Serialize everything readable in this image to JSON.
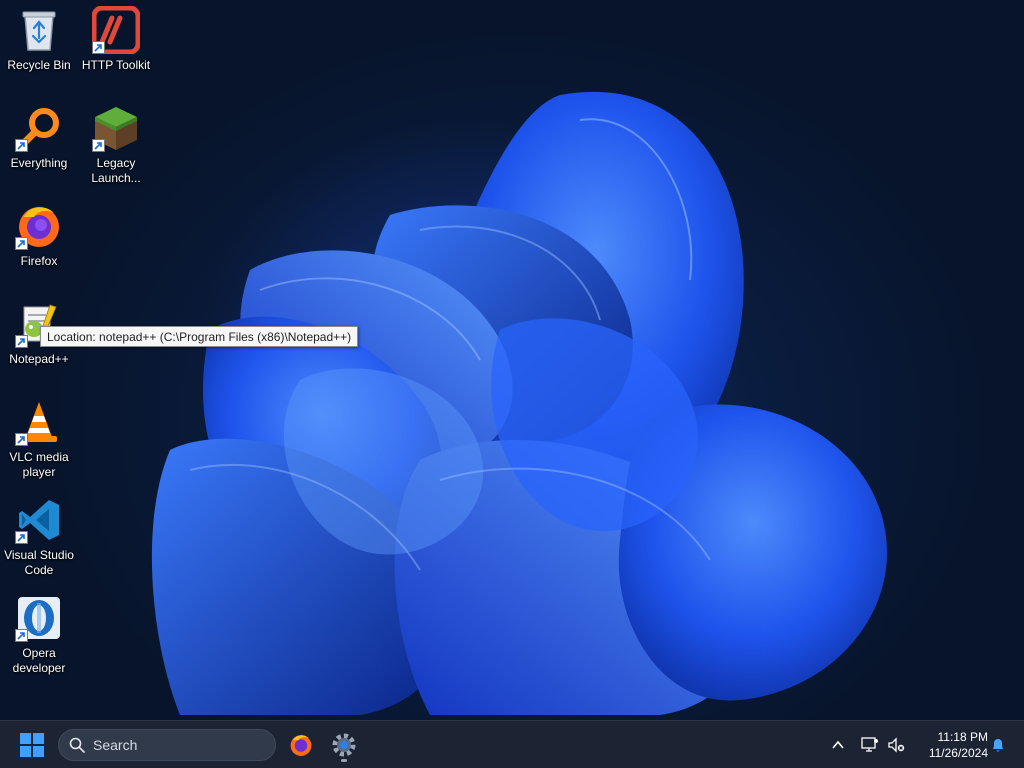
{
  "desktop": {
    "icons": [
      {
        "label": "Recycle Bin",
        "icon": "recycle-bin-icon"
      },
      {
        "label": "HTTP Toolkit",
        "icon": "http-toolkit-icon"
      },
      {
        "label": "Everything",
        "icon": "everything-search-icon"
      },
      {
        "label": "Legacy Launch...",
        "icon": "minecraft-grass-block-icon"
      },
      {
        "label": "Firefox",
        "icon": "firefox-icon"
      },
      {
        "label": "Notepad++",
        "icon": "notepad-plus-plus-icon"
      },
      {
        "label": "VLC media player",
        "icon": "vlc-cone-icon"
      },
      {
        "label": "Visual Studio Code",
        "icon": "vscode-icon"
      },
      {
        "label": "Opera developer",
        "icon": "opera-developer-icon"
      }
    ],
    "tooltip": "Location: notepad++ (C:\\Program Files (x86)\\Notepad++)"
  },
  "taskbar": {
    "search_label": "Search",
    "pinned": [
      {
        "name": "Firefox",
        "icon": "firefox-icon"
      },
      {
        "name": "Settings",
        "icon": "settings-gear-icon",
        "running": true
      }
    ],
    "tray": {
      "time": "11:18 PM",
      "date": "11/26/2024"
    }
  },
  "colors": {
    "accent": "#1f5bff",
    "taskbar": "#1c2433",
    "start_blue": "#3fa0ff"
  }
}
